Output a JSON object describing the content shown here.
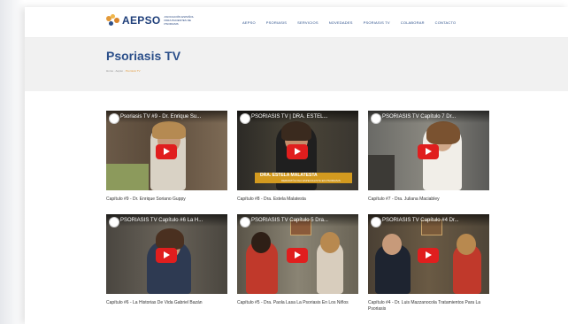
{
  "logo": {
    "text": "AEPSO",
    "subtitle": "ASOCIACIÓN ESPAÑOL PARA PACIENTES DE PSORIASIS"
  },
  "nav": [
    "AEPSO",
    "PSORIASIS",
    "SERVICIOS",
    "NOVEDADES",
    "PSORIASIS TV",
    "COLABORAR",
    "CONTACTO"
  ],
  "page": {
    "title": "Psoriasis TV"
  },
  "breadcrumb": [
    "Home",
    "Aepso",
    "Psoriasis TV"
  ],
  "videos": [
    {
      "title": "Psoriasis TV #9 - Dr. Enrique Su...",
      "caption": "Capítulo #9 - Dr. Enrique Soriano Guppy"
    },
    {
      "title": "PSORIASIS TV | DRA. ESTEL...",
      "caption": "Capítulo #8 - Dra. Estela Malatesta",
      "lower_third": {
        "name": "DRA. ESTELA MALATESTA",
        "sub": "DERMATÓLOGA ESPECIALISTA EN PSORIASIS"
      }
    },
    {
      "title": "PSORIASIS TV Capítulo 7 Dr...",
      "caption": "Capítulo #7 - Dra. Juliana Maciabley"
    },
    {
      "title": "PSORIASIS TV Capítulo #6 La H...",
      "caption": "Capítulo #6 - La Historias De Vida Gabriel Bazán"
    },
    {
      "title": "PSORIASIS TV Capítulo 5 Dra...",
      "caption": "Capítulo #5 - Dra. Paola Lasa La Psoriasis En Los Niños"
    },
    {
      "title": "PSORIASIS TV Capítulo #4 Dr...",
      "caption": "Capítulo #4 - Dr. Luis Mazzanocola Tratamientos Para La Psoriasis"
    }
  ],
  "colors": {
    "brand": "#2b4f8a",
    "accent": "#e39a3a",
    "play": "#e01e1e"
  }
}
